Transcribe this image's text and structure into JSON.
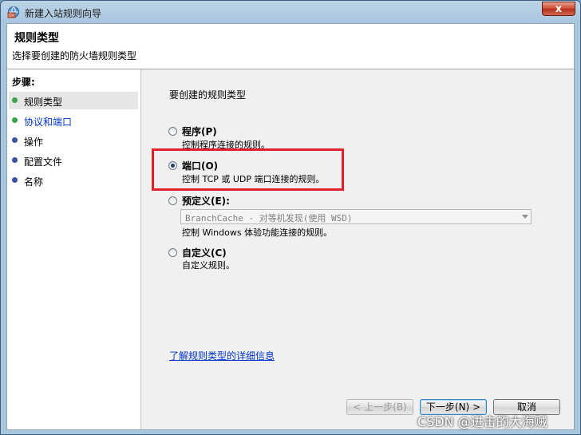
{
  "window": {
    "title": "新建入站规则向导",
    "close_label": "x"
  },
  "header": {
    "title": "规则类型",
    "subtitle": "选择要创建的防火墙规则类型"
  },
  "steps": {
    "title": "步骤:",
    "items": [
      {
        "label": "规则类型",
        "color": "#3aa24a"
      },
      {
        "label": "协议和端口",
        "color": "#3aa24a"
      },
      {
        "label": "操作",
        "color": "#3c4fa0"
      },
      {
        "label": "配置文件",
        "color": "#3c4fa0"
      },
      {
        "label": "名称",
        "color": "#3c4fa0"
      }
    ]
  },
  "main": {
    "prompt": "要创建的规则类型",
    "options": [
      {
        "title": "程序(P)",
        "desc": "控制程序连接的规则。",
        "selected": false
      },
      {
        "title": "端口(O)",
        "desc": "控制 TCP 或 UDP 端口连接的规则。",
        "selected": true
      },
      {
        "title": "预定义(E):",
        "desc": "控制 Windows 体验功能连接的规则。",
        "selected": false
      },
      {
        "title": "自定义(C)",
        "desc": "自定义规则。",
        "selected": false
      }
    ],
    "predefined_value": "BranchCache - 对等机发现(使用 WSD)",
    "help_link": "了解规则类型的详细信息"
  },
  "buttons": {
    "back": "< 上一步(B)",
    "next": "下一步(N) >",
    "cancel": "取消"
  },
  "watermark": "CSDN @进击的大海贼",
  "colors": {
    "highlight": "#e0202a",
    "link": "#0033cc"
  }
}
